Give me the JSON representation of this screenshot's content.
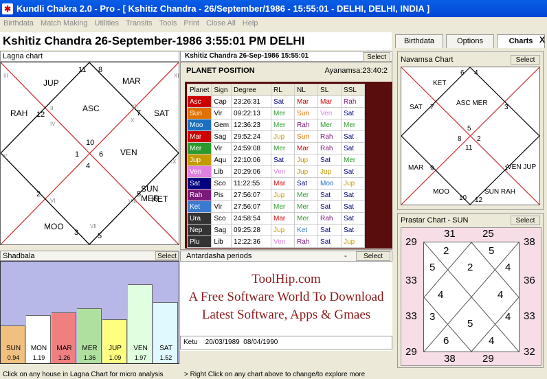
{
  "title": "Kundli Chakra 2.0 - Pro   -  [ Kshitiz Chandra  -  26/September/1986  -  15:55:01  -  DELHI, DELHI, INDIA ]",
  "menu": [
    "Birthdata",
    "Match Making",
    "Utilities",
    "Transits",
    "Tools",
    "Print",
    "Close All",
    "Help"
  ],
  "headline": "Kshitiz Chandra 26-September-1986  3:55:01 PM  DELHI",
  "lagna": {
    "title": "Lagna chart",
    "houses": [
      "12",
      "1",
      "2",
      "3",
      "4",
      "5",
      "6",
      "7",
      "8",
      "9",
      "10",
      "11"
    ],
    "planets": {
      "JUP": "JUP",
      "MAR": "MAR",
      "RAH": "RAH",
      "ASC": "ASC",
      "SAT": "SAT",
      "VEN": "VEN",
      "SUNMER": "SUN MER",
      "KET": "KET",
      "MOO": "MOO"
    },
    "roman": [
      "III",
      "II",
      "XII",
      "XI",
      "IX",
      "X",
      "VIII",
      "VII",
      "VI",
      "V",
      "IV",
      "I"
    ]
  },
  "planet_box": {
    "title": "Kshitiz Chandra 26-Sep-1986   15:55:01",
    "select": "Select",
    "heading": "PLANET POSITION",
    "ayanamsa": "Ayanamsa:23:40:2",
    "columns": [
      "Planet",
      "Sign",
      "Degree",
      "RL",
      "NL",
      "SL",
      "SSL"
    ],
    "rows": [
      [
        "Asc",
        "Cap",
        "23:26:31",
        "Sat",
        "Mar",
        "Mar",
        "Rah"
      ],
      [
        "Sun",
        "Vir",
        "09:22:13",
        "Mer",
        "Sun",
        "Ven",
        "Sat"
      ],
      [
        "Moo",
        "Gem",
        "12:36:23",
        "Mer",
        "Rah",
        "Mer",
        "Mer"
      ],
      [
        "Mar",
        "Sag",
        "29:52:24",
        "Jup",
        "Sun",
        "Rah",
        "Sat"
      ],
      [
        "Mer",
        "Vir",
        "24:59:08",
        "Mer",
        "Mar",
        "Rah",
        "Sat"
      ],
      [
        "Jup",
        "Aqu",
        "22:10:06",
        "Sat",
        "Jup",
        "Sat",
        "Mer"
      ],
      [
        "Ven",
        "Lib",
        "20:29:06",
        "Ven",
        "Jup",
        "Jup",
        "Sat"
      ],
      [
        "Sat",
        "Sco",
        "11:22:55",
        "Mar",
        "Sat",
        "Moo",
        "Jup"
      ],
      [
        "Rah",
        "Pis",
        "27:56:07",
        "Jup",
        "Mer",
        "Sat",
        "Sat"
      ],
      [
        "Ket",
        "Vir",
        "27:56:07",
        "Mer",
        "Mer",
        "Sat",
        "Sat"
      ],
      [
        "Ura",
        "Sco",
        "24:58:54",
        "Mar",
        "Mer",
        "Rah",
        "Sat"
      ],
      [
        "Nep",
        "Sag",
        "09:25:28",
        "Jup",
        "Ket",
        "Sat",
        "Sat"
      ],
      [
        "Plu",
        "Lib",
        "12:22:36",
        "Ven",
        "Rah",
        "Sat",
        "Jup"
      ]
    ]
  },
  "colors": {
    "Asc": "#c00",
    "Sun": "#e07000",
    "Moo": "#1a6fc0",
    "Mar": "#c00",
    "Mer": "#2a9a2a",
    "Jup": "#c49a00",
    "Ven": "#e080e0",
    "Sat": "#000080",
    "Rah": "#7a1a7a",
    "Ket": "#3a7ad0",
    "Ura": "#333",
    "Nep": "#333",
    "Plu": "#333"
  },
  "tabs": [
    "Birthdata",
    "Options",
    "Charts"
  ],
  "navamsa": {
    "title": "Navamsa Chart",
    "select": "Select",
    "houses": [
      "6",
      "4",
      "7",
      "3",
      "5",
      "8",
      "2",
      "11",
      "9",
      "1",
      "10",
      "12"
    ],
    "planets": {
      "KET": "KET",
      "ASCMER": "ASC MER",
      "SAT": "SAT",
      "MAR": "MAR",
      "VENJUP": "VEN JUP",
      "MOO": "MOO",
      "SUNRAH": "SUN RAH"
    }
  },
  "prastar": {
    "title": "Prastar Chart - SUN",
    "select": "Select",
    "outer": {
      "top": [
        "31",
        "25"
      ],
      "bottom": [
        "38",
        "29"
      ],
      "left": [
        "29",
        "33",
        "33",
        "29"
      ],
      "right": [
        "38",
        "36",
        "33",
        "32"
      ]
    },
    "inner": [
      "2",
      "5",
      "5",
      "4",
      "2",
      "4",
      "4",
      "4",
      "3",
      "5",
      "4",
      "6",
      "4"
    ],
    "small": [
      "11",
      "9",
      "12",
      "10",
      "1",
      "7",
      "2",
      "8",
      "3",
      "6"
    ]
  },
  "shadbala": {
    "title": "Shadbala",
    "select": "Select",
    "bars": [
      {
        "name": "SUN",
        "value": "0.94",
        "level": 0.37,
        "color": "#f0c080"
      },
      {
        "name": "MON",
        "value": "1.19",
        "level": 0.47,
        "color": "#ffffff"
      },
      {
        "name": "MAR",
        "value": "1.26",
        "level": 0.5,
        "color": "#f08080"
      },
      {
        "name": "MER",
        "value": "1.36",
        "level": 0.54,
        "color": "#b0e0a0"
      },
      {
        "name": "JUP",
        "value": "1.09",
        "level": 0.43,
        "color": "#ffff80"
      },
      {
        "name": "VEN",
        "value": "1.97",
        "level": 0.78,
        "color": "#e0ffe0"
      },
      {
        "name": "SAT",
        "value": "1.52",
        "level": 0.6,
        "color": "#e0f8ff"
      }
    ]
  },
  "antardasha": {
    "title": "Antardasha periods",
    "select": "Select",
    "row": "Ketu    20/03/1989  08/04/1990"
  },
  "watermark": {
    "line1": "ToolHip.com",
    "line2": "A Free Software World To Download",
    "line3": "Latest Software, Apps & Gmaes"
  },
  "status": {
    "left": "Click on any house in Lagna Chart for micro analysis",
    "right": "> Right Click on any chart above to change/to explore more"
  }
}
